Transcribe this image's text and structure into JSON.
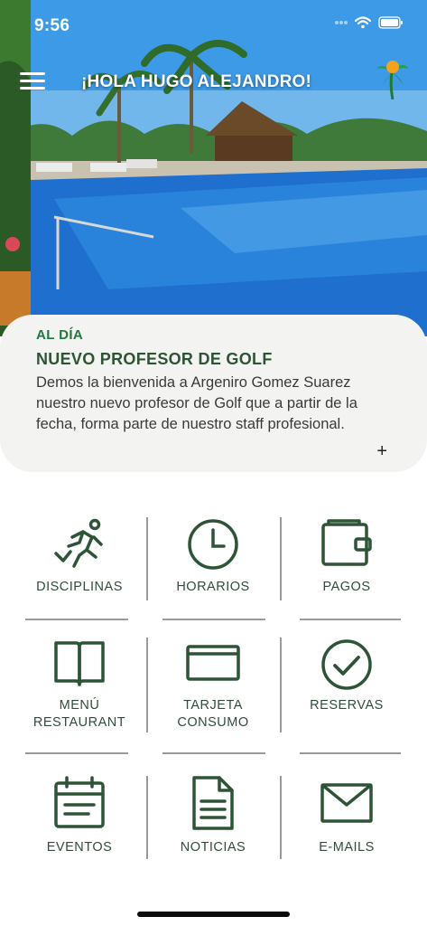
{
  "status_bar": {
    "time": "9:56"
  },
  "header": {
    "greeting": "¡HOLA HUGO ALEJANDRO!"
  },
  "news": {
    "category": "AL DÍA",
    "title": "NUEVO PROFESOR DE GOLF",
    "body": "Demos la bienvenida a Argeniro Gomez Suarez nuestro nuevo profesor de Golf que a partir de la fecha, forma parte de nuestro staff profesional.",
    "more": "+"
  },
  "menu": {
    "disciplinas": "DISCIPLINAS",
    "horarios": "HORARIOS",
    "pagos": "PAGOS",
    "menu_restaurant_1": "MENÚ",
    "menu_restaurant_2": "RESTAURANT",
    "tarjeta_1": "TARJETA",
    "tarjeta_2": "CONSUMO",
    "reservas": "RESERVAS",
    "eventos": "EVENTOS",
    "noticias": "NOTICIAS",
    "emails": "E-MAILS"
  },
  "colors": {
    "accent_green": "#2e5436",
    "category_green": "#1d7a3c",
    "card_bg": "#f3f3f1"
  },
  "icons": [
    "hamburger-icon",
    "palm-tree-logo",
    "athlete-icon",
    "clock-icon",
    "wallet-icon",
    "book-icon",
    "card-icon",
    "check-circle-icon",
    "calendar-icon",
    "document-icon",
    "mail-icon"
  ]
}
